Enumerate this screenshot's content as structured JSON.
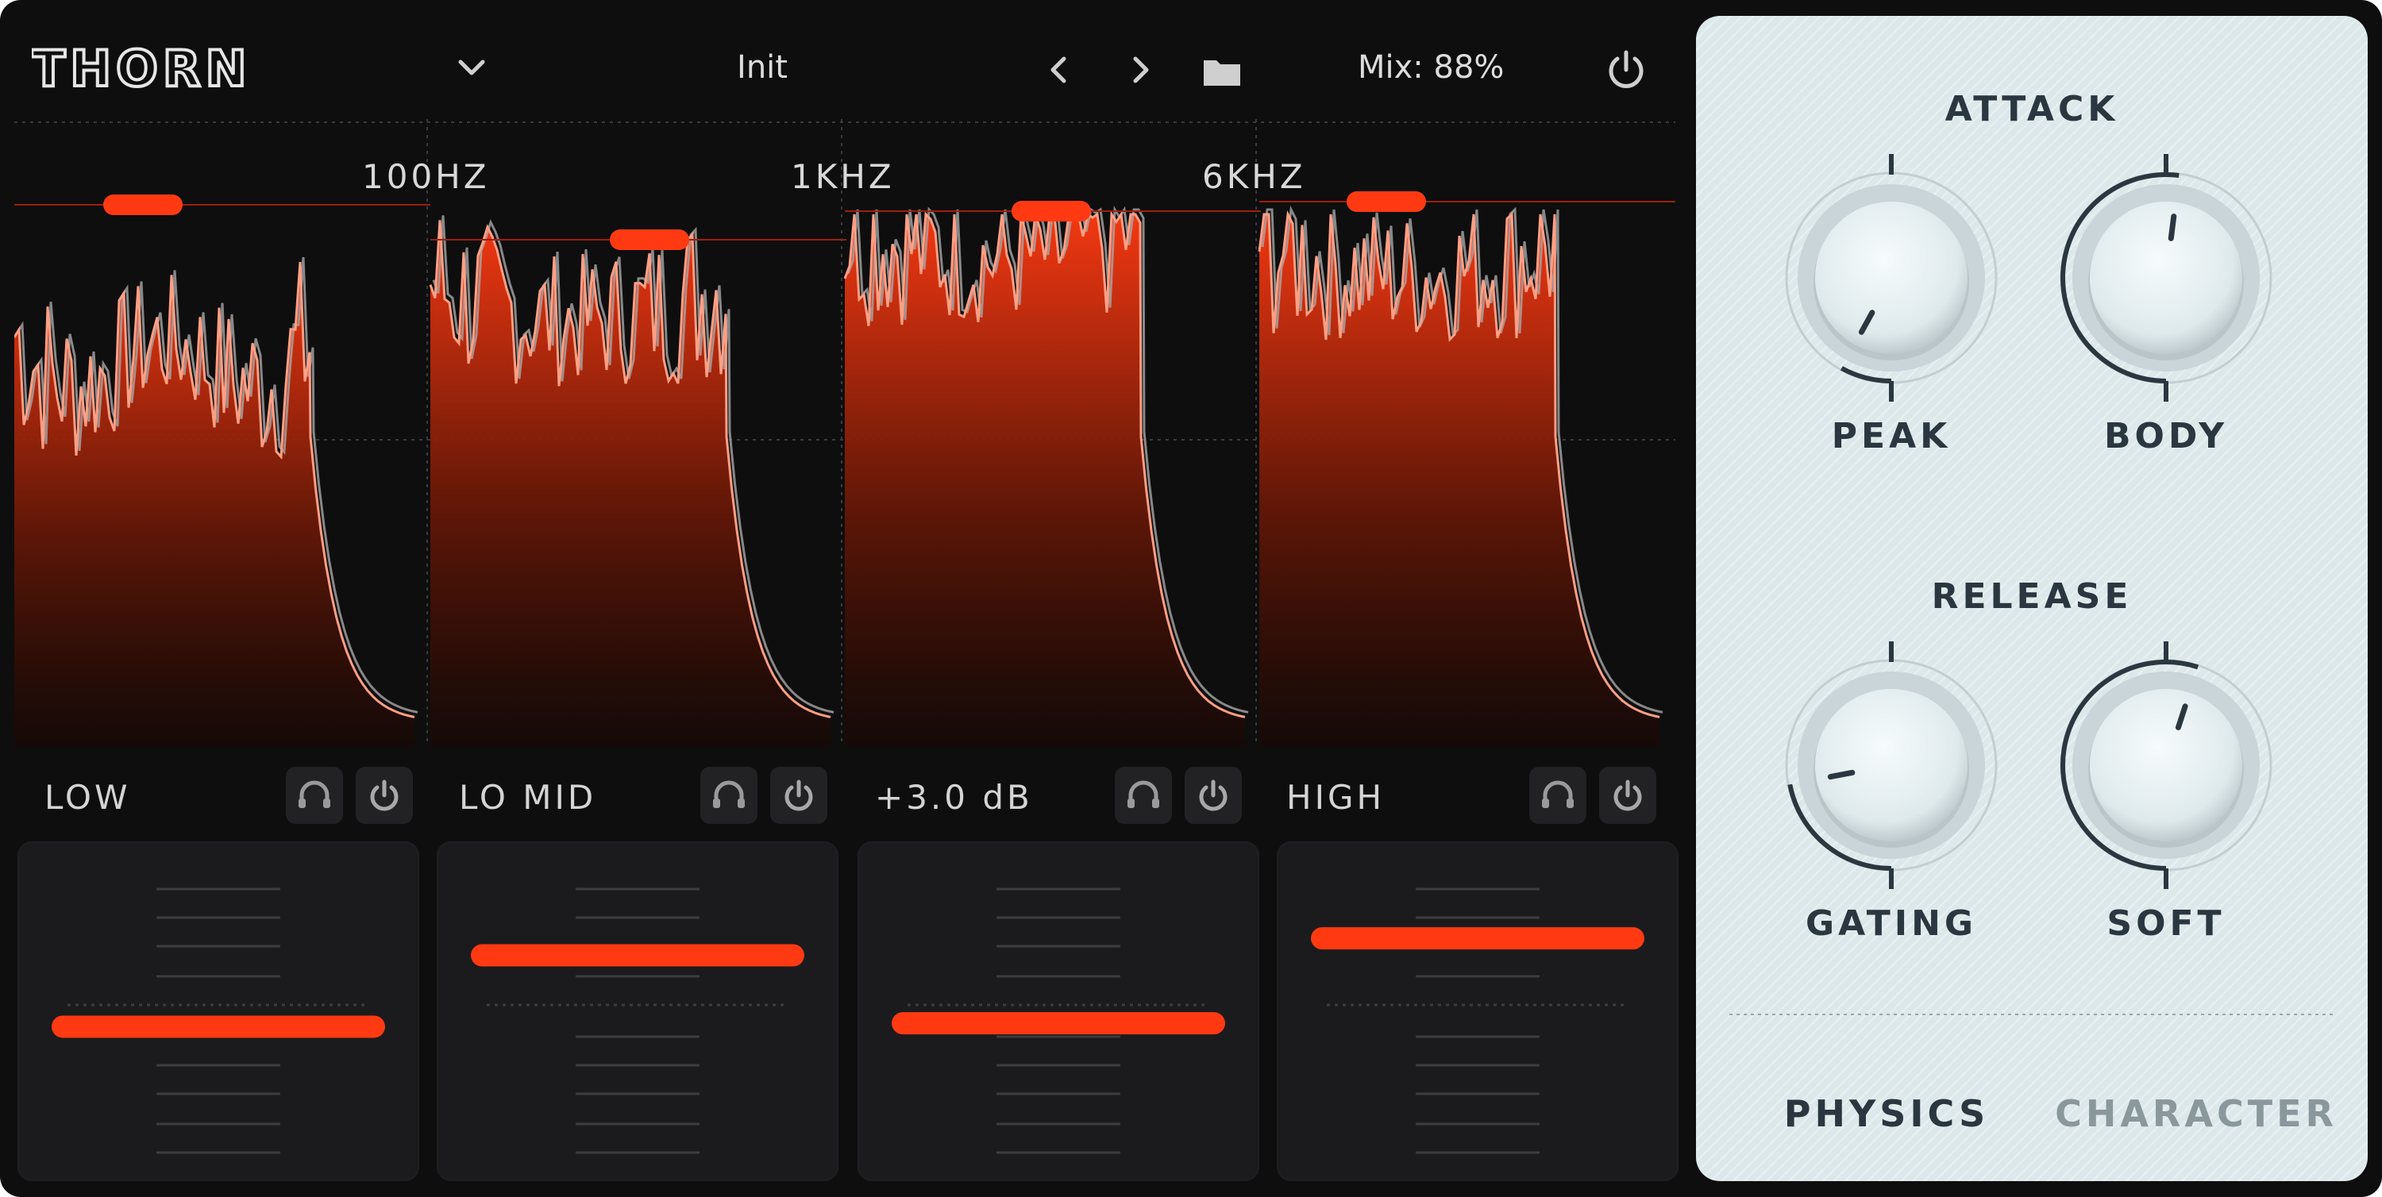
{
  "app": {
    "logo": "THORN"
  },
  "topbar": {
    "preset": "Init",
    "mix_label": "Mix: 88%",
    "icons": {
      "dropdown": "chevron-down-icon",
      "prev": "chevron-left-icon",
      "next": "chevron-right-icon",
      "folder": "folder-icon",
      "power": "power-icon"
    }
  },
  "crossovers": [
    "100HZ",
    "1KHZ",
    "6KHZ"
  ],
  "bands": [
    {
      "label": "LOW",
      "gain_level": 0.52
    },
    {
      "label": "LO MID",
      "gain_level": 0.73
    },
    {
      "label": "+3.0 dB",
      "gain_level": 0.53
    },
    {
      "label": "HIGH",
      "gain_level": 0.78
    }
  ],
  "band_icons": {
    "solo": "headphones-icon",
    "bypass": "power-icon"
  },
  "panel": {
    "attack_title": "ATTACK",
    "release_title": "RELEASE",
    "knobs": [
      {
        "label": "PEAK",
        "value": 0.08
      },
      {
        "label": "BODY",
        "value": 0.52
      },
      {
        "label": "GATING",
        "value": 0.22
      },
      {
        "label": "SOFT",
        "value": 0.55
      }
    ],
    "tabs": [
      {
        "label": "PHYSICS",
        "active": true
      },
      {
        "label": "CHARACTER",
        "active": false
      }
    ]
  },
  "colors": {
    "accent": "#ff3a12",
    "background": "#0e0e0f",
    "panel": "#dde8ea",
    "panel_text": "#2b3740",
    "tab_inactive": "#8a979c"
  }
}
